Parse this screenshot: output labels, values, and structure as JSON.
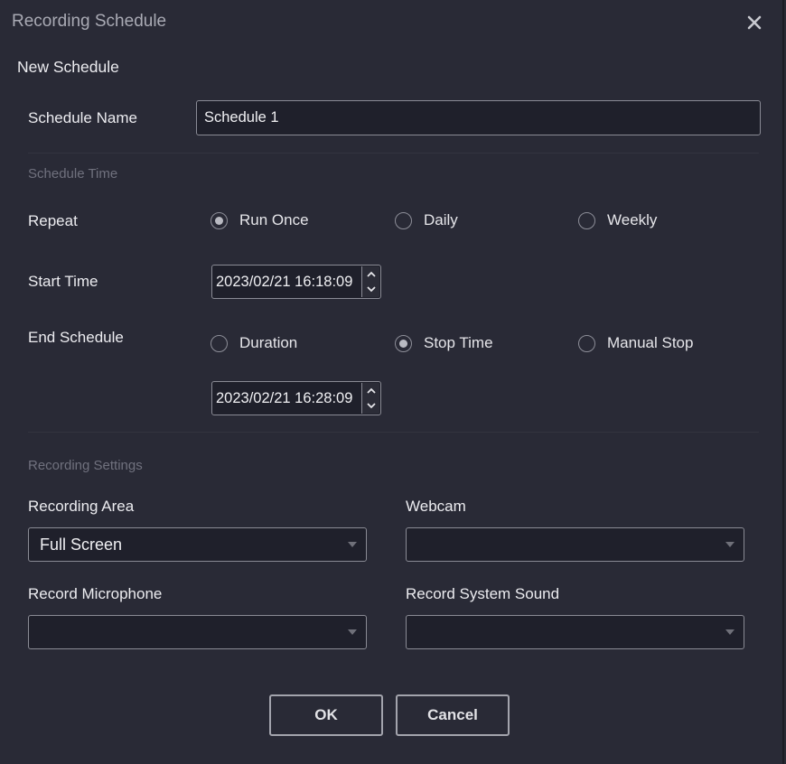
{
  "window": {
    "title": "Recording Schedule"
  },
  "section_title": "New Schedule",
  "schedule_name": {
    "label": "Schedule Name",
    "value": "Schedule 1"
  },
  "schedule_time": {
    "heading": "Schedule Time",
    "repeat": {
      "label": "Repeat",
      "options": [
        "Run Once",
        "Daily",
        "Weekly"
      ],
      "selected": "Run Once"
    },
    "start_time": {
      "label": "Start Time",
      "value": "2023/02/21 16:18:09"
    },
    "end_schedule": {
      "label": "End Schedule",
      "options": [
        "Duration",
        "Stop Time",
        "Manual Stop"
      ],
      "selected": "Stop Time",
      "stop_time_value": "2023/02/21 16:28:09"
    }
  },
  "recording_settings": {
    "heading": "Recording Settings",
    "recording_area": {
      "label": "Recording Area",
      "value": "Full Screen"
    },
    "webcam": {
      "label": "Webcam",
      "value": ""
    },
    "record_microphone": {
      "label": "Record Microphone",
      "value": ""
    },
    "record_system_sound": {
      "label": "Record System Sound",
      "value": ""
    }
  },
  "buttons": {
    "ok": "OK",
    "cancel": "Cancel"
  },
  "icons": {
    "close": "close-icon",
    "spin_up": "chevron-up-icon",
    "spin_down": "chevron-down-icon",
    "dropdown": "caret-down-icon"
  },
  "colors": {
    "background": "#292a36",
    "input_bg": "#1f202b",
    "border": "#8a8b95",
    "muted_text": "#70717e"
  }
}
